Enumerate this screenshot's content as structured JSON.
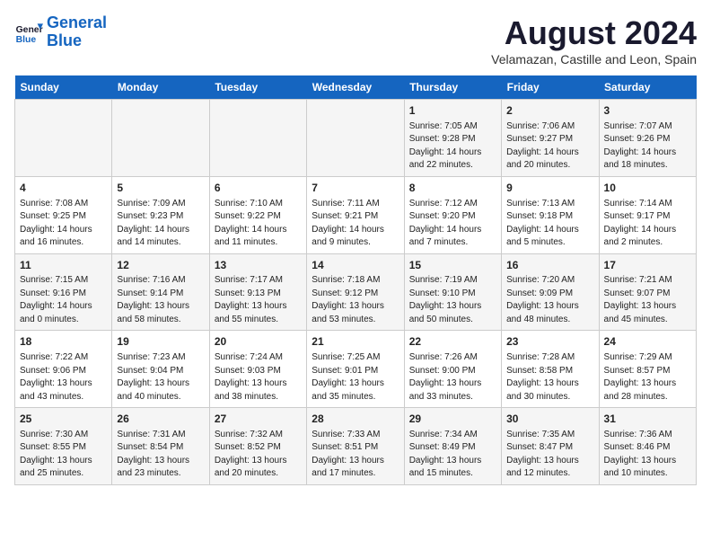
{
  "header": {
    "logo_line1": "General",
    "logo_line2": "Blue",
    "main_title": "August 2024",
    "subtitle": "Velamazan, Castille and Leon, Spain"
  },
  "weekdays": [
    "Sunday",
    "Monday",
    "Tuesday",
    "Wednesday",
    "Thursday",
    "Friday",
    "Saturday"
  ],
  "weeks": [
    [
      {
        "day": "",
        "info": ""
      },
      {
        "day": "",
        "info": ""
      },
      {
        "day": "",
        "info": ""
      },
      {
        "day": "",
        "info": ""
      },
      {
        "day": "1",
        "info": "Sunrise: 7:05 AM\nSunset: 9:28 PM\nDaylight: 14 hours\nand 22 minutes."
      },
      {
        "day": "2",
        "info": "Sunrise: 7:06 AM\nSunset: 9:27 PM\nDaylight: 14 hours\nand 20 minutes."
      },
      {
        "day": "3",
        "info": "Sunrise: 7:07 AM\nSunset: 9:26 PM\nDaylight: 14 hours\nand 18 minutes."
      }
    ],
    [
      {
        "day": "4",
        "info": "Sunrise: 7:08 AM\nSunset: 9:25 PM\nDaylight: 14 hours\nand 16 minutes."
      },
      {
        "day": "5",
        "info": "Sunrise: 7:09 AM\nSunset: 9:23 PM\nDaylight: 14 hours\nand 14 minutes."
      },
      {
        "day": "6",
        "info": "Sunrise: 7:10 AM\nSunset: 9:22 PM\nDaylight: 14 hours\nand 11 minutes."
      },
      {
        "day": "7",
        "info": "Sunrise: 7:11 AM\nSunset: 9:21 PM\nDaylight: 14 hours\nand 9 minutes."
      },
      {
        "day": "8",
        "info": "Sunrise: 7:12 AM\nSunset: 9:20 PM\nDaylight: 14 hours\nand 7 minutes."
      },
      {
        "day": "9",
        "info": "Sunrise: 7:13 AM\nSunset: 9:18 PM\nDaylight: 14 hours\nand 5 minutes."
      },
      {
        "day": "10",
        "info": "Sunrise: 7:14 AM\nSunset: 9:17 PM\nDaylight: 14 hours\nand 2 minutes."
      }
    ],
    [
      {
        "day": "11",
        "info": "Sunrise: 7:15 AM\nSunset: 9:16 PM\nDaylight: 14 hours\nand 0 minutes."
      },
      {
        "day": "12",
        "info": "Sunrise: 7:16 AM\nSunset: 9:14 PM\nDaylight: 13 hours\nand 58 minutes."
      },
      {
        "day": "13",
        "info": "Sunrise: 7:17 AM\nSunset: 9:13 PM\nDaylight: 13 hours\nand 55 minutes."
      },
      {
        "day": "14",
        "info": "Sunrise: 7:18 AM\nSunset: 9:12 PM\nDaylight: 13 hours\nand 53 minutes."
      },
      {
        "day": "15",
        "info": "Sunrise: 7:19 AM\nSunset: 9:10 PM\nDaylight: 13 hours\nand 50 minutes."
      },
      {
        "day": "16",
        "info": "Sunrise: 7:20 AM\nSunset: 9:09 PM\nDaylight: 13 hours\nand 48 minutes."
      },
      {
        "day": "17",
        "info": "Sunrise: 7:21 AM\nSunset: 9:07 PM\nDaylight: 13 hours\nand 45 minutes."
      }
    ],
    [
      {
        "day": "18",
        "info": "Sunrise: 7:22 AM\nSunset: 9:06 PM\nDaylight: 13 hours\nand 43 minutes."
      },
      {
        "day": "19",
        "info": "Sunrise: 7:23 AM\nSunset: 9:04 PM\nDaylight: 13 hours\nand 40 minutes."
      },
      {
        "day": "20",
        "info": "Sunrise: 7:24 AM\nSunset: 9:03 PM\nDaylight: 13 hours\nand 38 minutes."
      },
      {
        "day": "21",
        "info": "Sunrise: 7:25 AM\nSunset: 9:01 PM\nDaylight: 13 hours\nand 35 minutes."
      },
      {
        "day": "22",
        "info": "Sunrise: 7:26 AM\nSunset: 9:00 PM\nDaylight: 13 hours\nand 33 minutes."
      },
      {
        "day": "23",
        "info": "Sunrise: 7:28 AM\nSunset: 8:58 PM\nDaylight: 13 hours\nand 30 minutes."
      },
      {
        "day": "24",
        "info": "Sunrise: 7:29 AM\nSunset: 8:57 PM\nDaylight: 13 hours\nand 28 minutes."
      }
    ],
    [
      {
        "day": "25",
        "info": "Sunrise: 7:30 AM\nSunset: 8:55 PM\nDaylight: 13 hours\nand 25 minutes."
      },
      {
        "day": "26",
        "info": "Sunrise: 7:31 AM\nSunset: 8:54 PM\nDaylight: 13 hours\nand 23 minutes."
      },
      {
        "day": "27",
        "info": "Sunrise: 7:32 AM\nSunset: 8:52 PM\nDaylight: 13 hours\nand 20 minutes."
      },
      {
        "day": "28",
        "info": "Sunrise: 7:33 AM\nSunset: 8:51 PM\nDaylight: 13 hours\nand 17 minutes."
      },
      {
        "day": "29",
        "info": "Sunrise: 7:34 AM\nSunset: 8:49 PM\nDaylight: 13 hours\nand 15 minutes."
      },
      {
        "day": "30",
        "info": "Sunrise: 7:35 AM\nSunset: 8:47 PM\nDaylight: 13 hours\nand 12 minutes."
      },
      {
        "day": "31",
        "info": "Sunrise: 7:36 AM\nSunset: 8:46 PM\nDaylight: 13 hours\nand 10 minutes."
      }
    ]
  ]
}
